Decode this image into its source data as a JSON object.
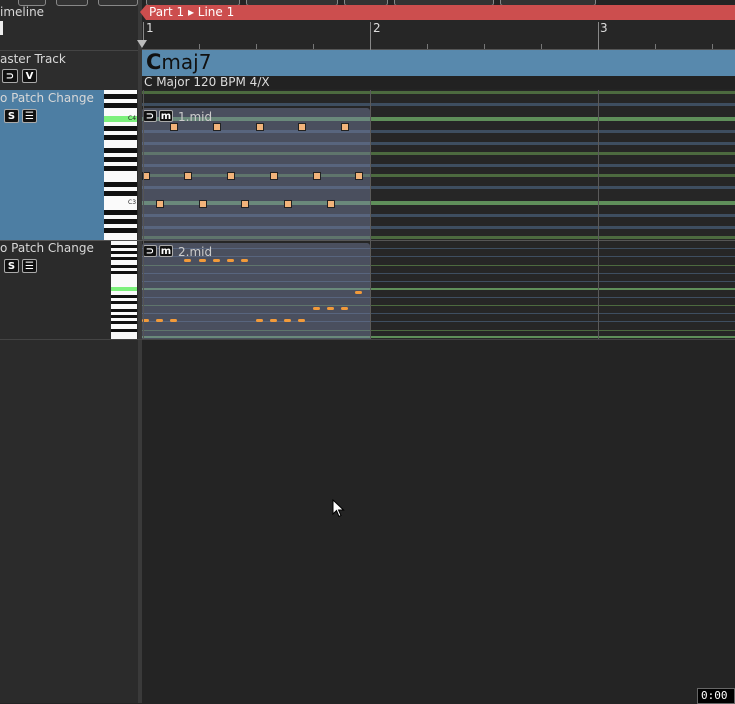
{
  "topbar": {
    "part_tab": "Part 1 ▸ Line 1"
  },
  "ruler": {
    "bars": [
      "1",
      "2",
      "3"
    ]
  },
  "tracks": {
    "timeline_label": "imeline",
    "master_label": "aster Track",
    "master_buttons": [
      "⊃",
      "V"
    ],
    "track1": {
      "label": "o Patch Change",
      "buttons": [
        "S",
        "☰"
      ],
      "piano_marks": [
        "C4",
        "C3"
      ],
      "clip_label": "1.mid",
      "clip_buttons": [
        "⊃",
        "m"
      ]
    },
    "track2": {
      "label": "o Patch Change",
      "buttons": [
        "S",
        "☰"
      ],
      "clip_label": "2.mid",
      "clip_buttons": [
        "⊃",
        "m"
      ]
    }
  },
  "chord": {
    "root": "C",
    "quality": "maj7",
    "key_info": "C Major  120 BPM  4/X"
  },
  "colors": {
    "accent_red": "#cc4e4e",
    "track_blue": "#4d7ea3",
    "chord_blue": "#5889ad",
    "lane_green": "#5f8f5a",
    "note_orange": "#f2b37a"
  },
  "status": {
    "clock": "0:00"
  }
}
